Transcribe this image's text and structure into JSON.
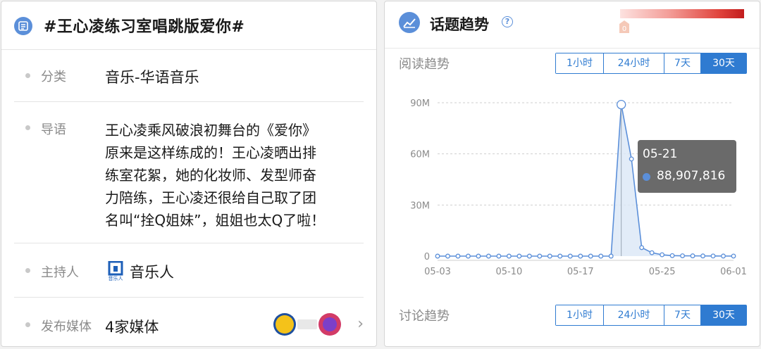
{
  "left": {
    "title": "#王心凌练习室唱跳版爱你#",
    "category": {
      "label": "分类",
      "value": "音乐-华语音乐"
    },
    "intro": {
      "label": "导语",
      "lines": [
        "王心凌乘风破浪初舞台的《爱你》",
        "原来是这样练成的！王心凌晒出排",
        "练室花絮，她的化妆师、发型师奋",
        "力陪练，王心凌还很给自己取了团",
        "名叫“拴Q姐妹”，姐姐也太Q了啦！"
      ]
    },
    "host": {
      "label": "主持人",
      "value": "音乐人",
      "logo_text": "音乐人"
    },
    "media": {
      "label": "发布媒体",
      "value": "4家媒体",
      "icon_names": [
        "media-logo-1",
        "media-logo-2",
        "media-logo-3"
      ]
    }
  },
  "right": {
    "title": "话题趋势",
    "legend_min": "0",
    "read_trend": {
      "label": "阅读趋势",
      "ranges": [
        "1小时",
        "24小时",
        "7天",
        "30天"
      ],
      "active": "30天"
    },
    "discussion_trend": {
      "label": "讨论趋势",
      "ranges": [
        "1小时",
        "24小时",
        "7天",
        "30天"
      ],
      "active": "30天"
    },
    "tooltip": {
      "date": "05-21",
      "value": "88,907,816"
    },
    "colors": {
      "accent": "#2f7bd1",
      "series": "#5b8fd9",
      "legend_high": "#c21d1d"
    }
  },
  "chart_data": {
    "type": "area",
    "x": [
      "05-03",
      "05-04",
      "05-05",
      "05-06",
      "05-07",
      "05-08",
      "05-09",
      "05-10",
      "05-11",
      "05-12",
      "05-13",
      "05-14",
      "05-15",
      "05-16",
      "05-17",
      "05-18",
      "05-19",
      "05-20",
      "05-21",
      "05-22",
      "05-23",
      "05-24",
      "05-25",
      "05-26",
      "05-27",
      "05-28",
      "05-29",
      "05-30",
      "05-31",
      "06-01"
    ],
    "values": [
      0,
      0,
      0,
      0,
      0,
      0,
      0,
      0,
      0,
      0,
      0,
      0,
      0,
      0,
      0,
      0,
      0,
      0,
      88907816,
      57000000,
      5000000,
      2000000,
      800000,
      300000,
      200000,
      150000,
      100000,
      80000,
      50000,
      40000
    ],
    "xticks": [
      "05-03",
      "05-10",
      "05-17",
      "05-25",
      "06-01"
    ],
    "yticks": [
      "0",
      "30M",
      "60M",
      "90M"
    ],
    "ylim": [
      0,
      90000000
    ],
    "grid": true
  }
}
